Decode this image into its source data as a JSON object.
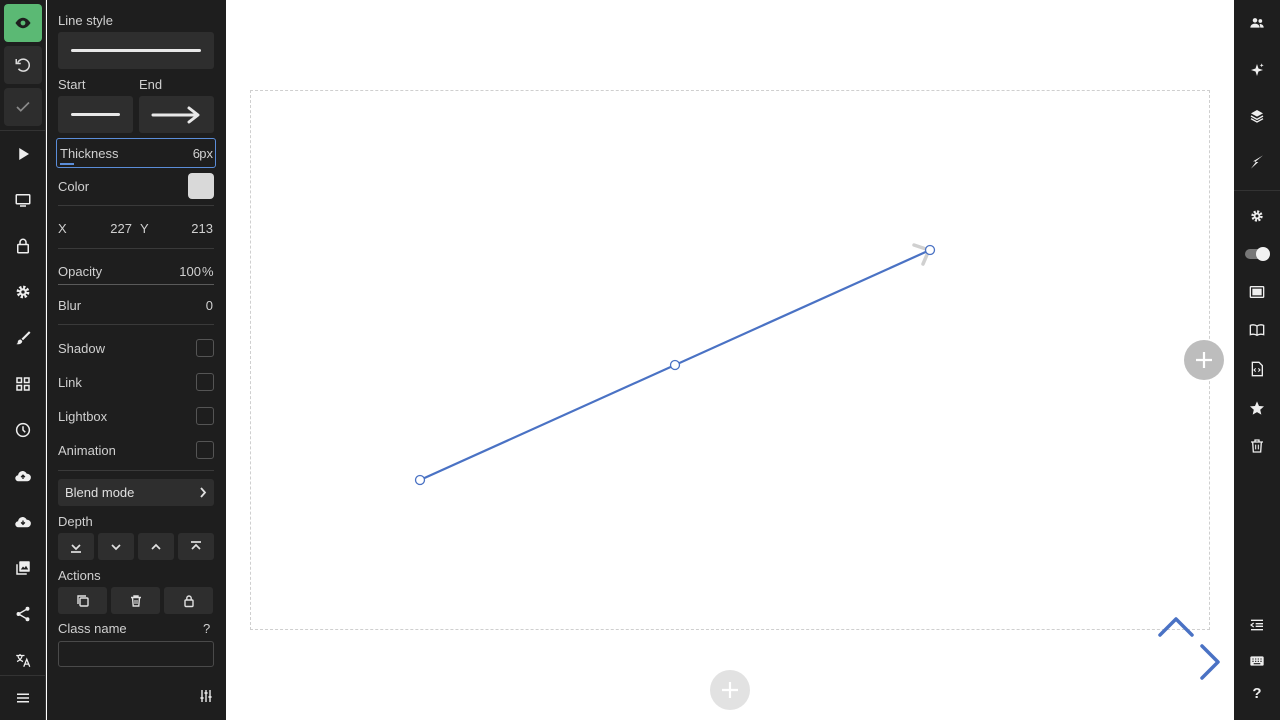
{
  "panel": {
    "line_style_label": "Line style",
    "start_label": "Start",
    "end_label": "End",
    "thickness_label": "Thickness",
    "thickness_value": "6",
    "thickness_unit": "px",
    "color_label": "Color",
    "color_value": "#d9d9d9",
    "x_label": "X",
    "x_value": "227",
    "y_label": "Y",
    "y_value": "213",
    "opacity_label": "Opacity",
    "opacity_value": "100",
    "opacity_unit": "%",
    "blur_label": "Blur",
    "blur_value": "0",
    "shadow_label": "Shadow",
    "link_label": "Link",
    "lightbox_label": "Lightbox",
    "animation_label": "Animation",
    "blend_mode_label": "Blend mode",
    "depth_label": "Depth",
    "actions_label": "Actions",
    "class_name_label": "Class name",
    "class_name_help": "?",
    "class_name_value": ""
  },
  "colors": {
    "accent": "#5b8dd9",
    "line": "#4a72c4",
    "active_green": "#5bb974",
    "panel_bg": "#1e1e1e",
    "field_bg": "#2e2e2e",
    "add_button": "#bdbdbd"
  },
  "icons": {
    "left_rail": [
      "eye-icon",
      "undo-icon",
      "check-icon",
      "play-icon",
      "monitor-icon",
      "lock-icon",
      "gear-icon",
      "brush-icon",
      "grid-icon",
      "clock-icon",
      "cloud-upload-icon",
      "cloud-download-icon",
      "images-icon",
      "share-icon",
      "translate-icon",
      "menu-icon"
    ],
    "right_rail": [
      "users-icon",
      "sparkle-icon",
      "layers-icon",
      "lightning-icon",
      "gear-icon",
      "toggle-icon",
      "frame-icon",
      "book-icon",
      "code-file-icon",
      "star-icon",
      "trash-icon",
      "outdent-icon",
      "keyboard-icon",
      "help-icon"
    ]
  },
  "right_rail": {
    "help_label": "?"
  }
}
